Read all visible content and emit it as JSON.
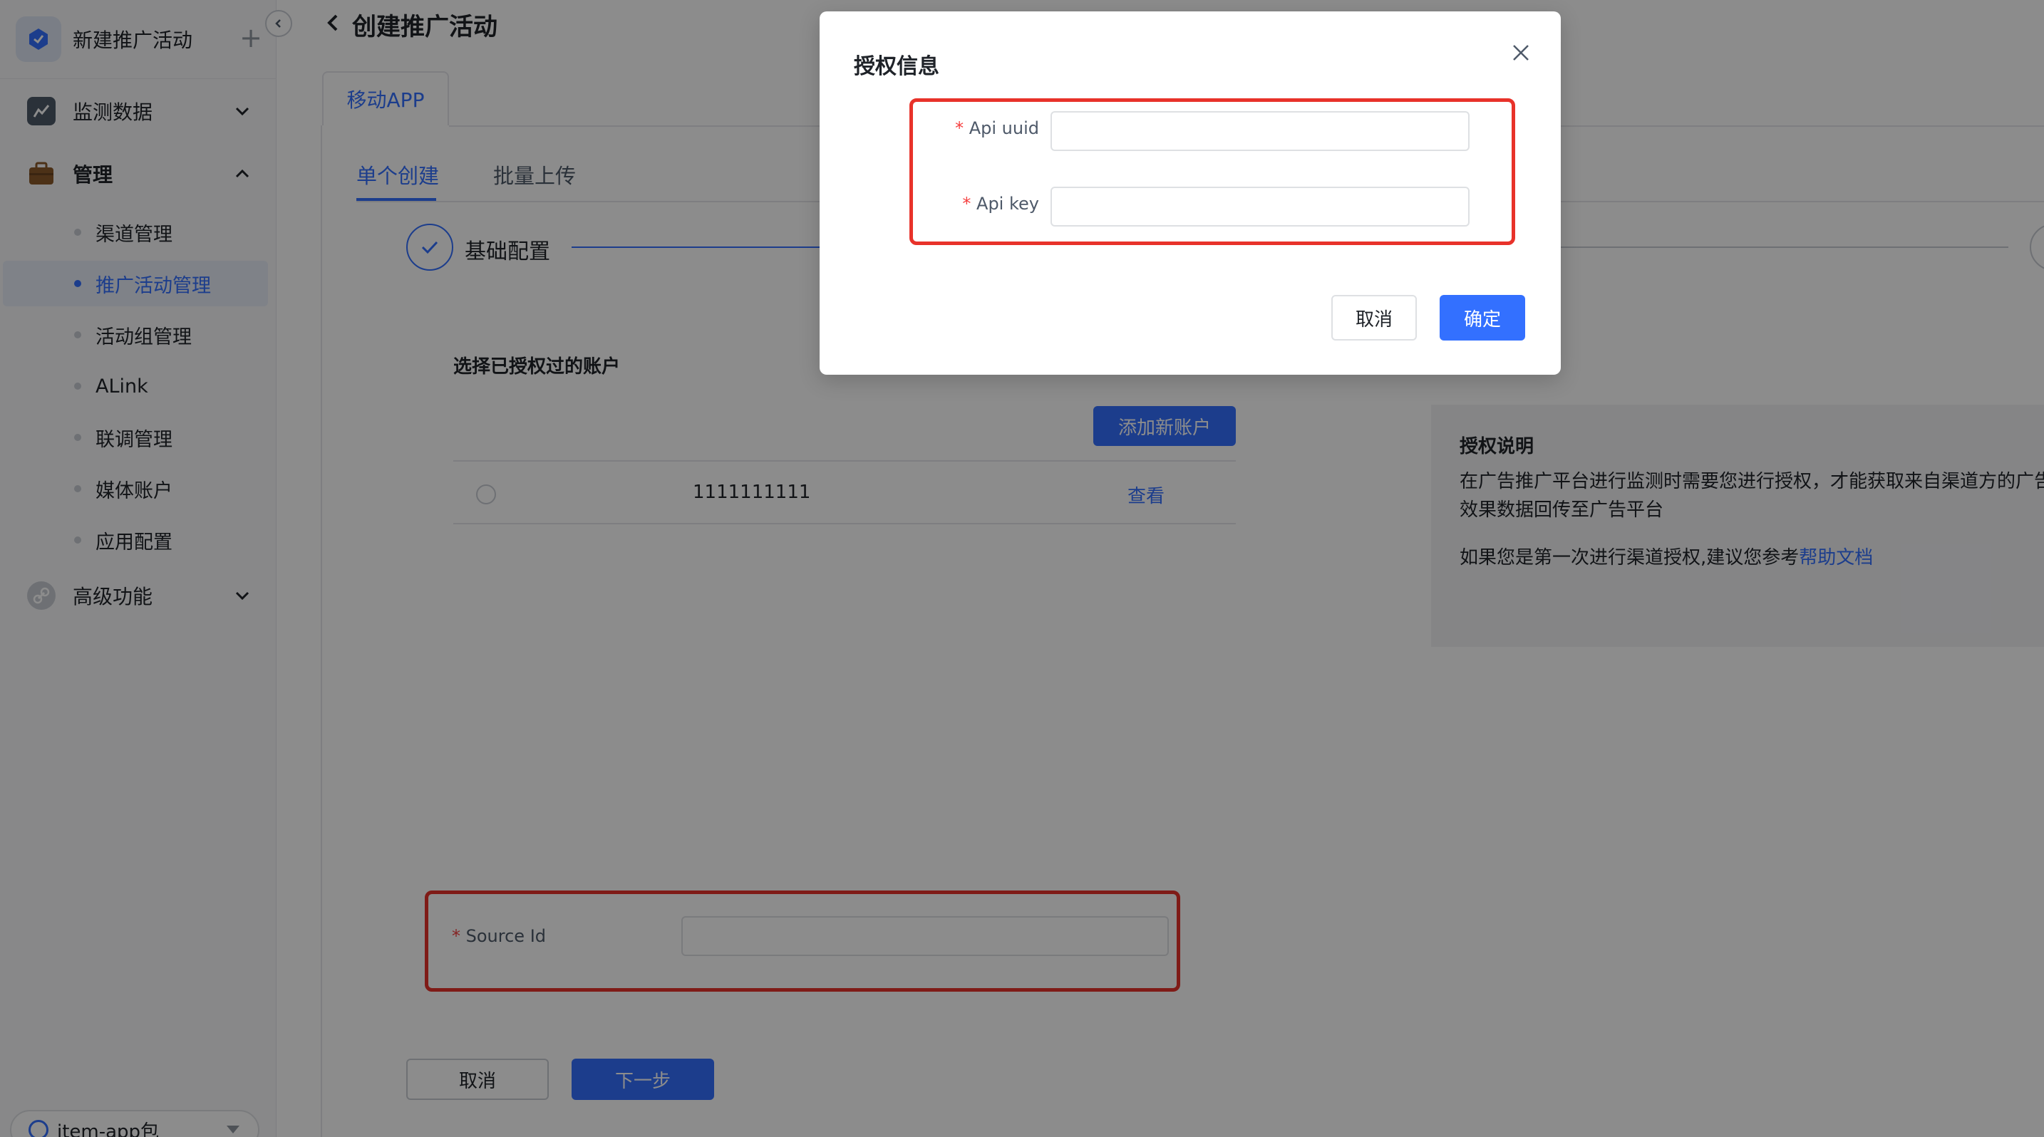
{
  "sidebar": {
    "brand_title": "新建推广活动",
    "menu": [
      {
        "label": "监测数据",
        "icon": "chart-icon"
      },
      {
        "label": "管理",
        "icon": "briefcase-icon"
      },
      {
        "label": "高级功能",
        "icon": "link-icon"
      }
    ],
    "sub_items": [
      "渠道管理",
      "推广活动管理",
      "活动组管理",
      "ALink",
      "联调管理",
      "媒体账户",
      "应用配置"
    ],
    "active_sub": "推广活动管理",
    "app_selector": "item-app包"
  },
  "page": {
    "title": "创建推广活动",
    "card_tab": "移动APP",
    "subtabs": [
      "单个创建",
      "批量上传"
    ],
    "step_label": "基础配置"
  },
  "accounts": {
    "label": "选择已授权过的账户",
    "add_button": "添加新账户",
    "rows": [
      {
        "id": "1111111111",
        "action": "查看"
      }
    ]
  },
  "source": {
    "label": "Source Id",
    "required_mark": "*"
  },
  "footer": {
    "cancel": "取消",
    "next": "下一步"
  },
  "info": {
    "title": "授权说明",
    "line1": "在广告推广平台进行监测时需要您进行授权，才能获取来自渠道方的广告",
    "line2": "效果数据回传至广告平台",
    "line3_prefix": "如果您是第一次进行渠道授权,建议您参考",
    "line3_link": "帮助文档"
  },
  "modal": {
    "title": "授权信息",
    "fields": [
      {
        "label": "Api uuid",
        "value": ""
      },
      {
        "label": "Api key",
        "value": ""
      }
    ],
    "required_mark": "*",
    "cancel": "取消",
    "ok": "确定"
  },
  "colors": {
    "accent": "#3370ff",
    "highlight": "#e8322a",
    "required": "#f53f3f"
  }
}
